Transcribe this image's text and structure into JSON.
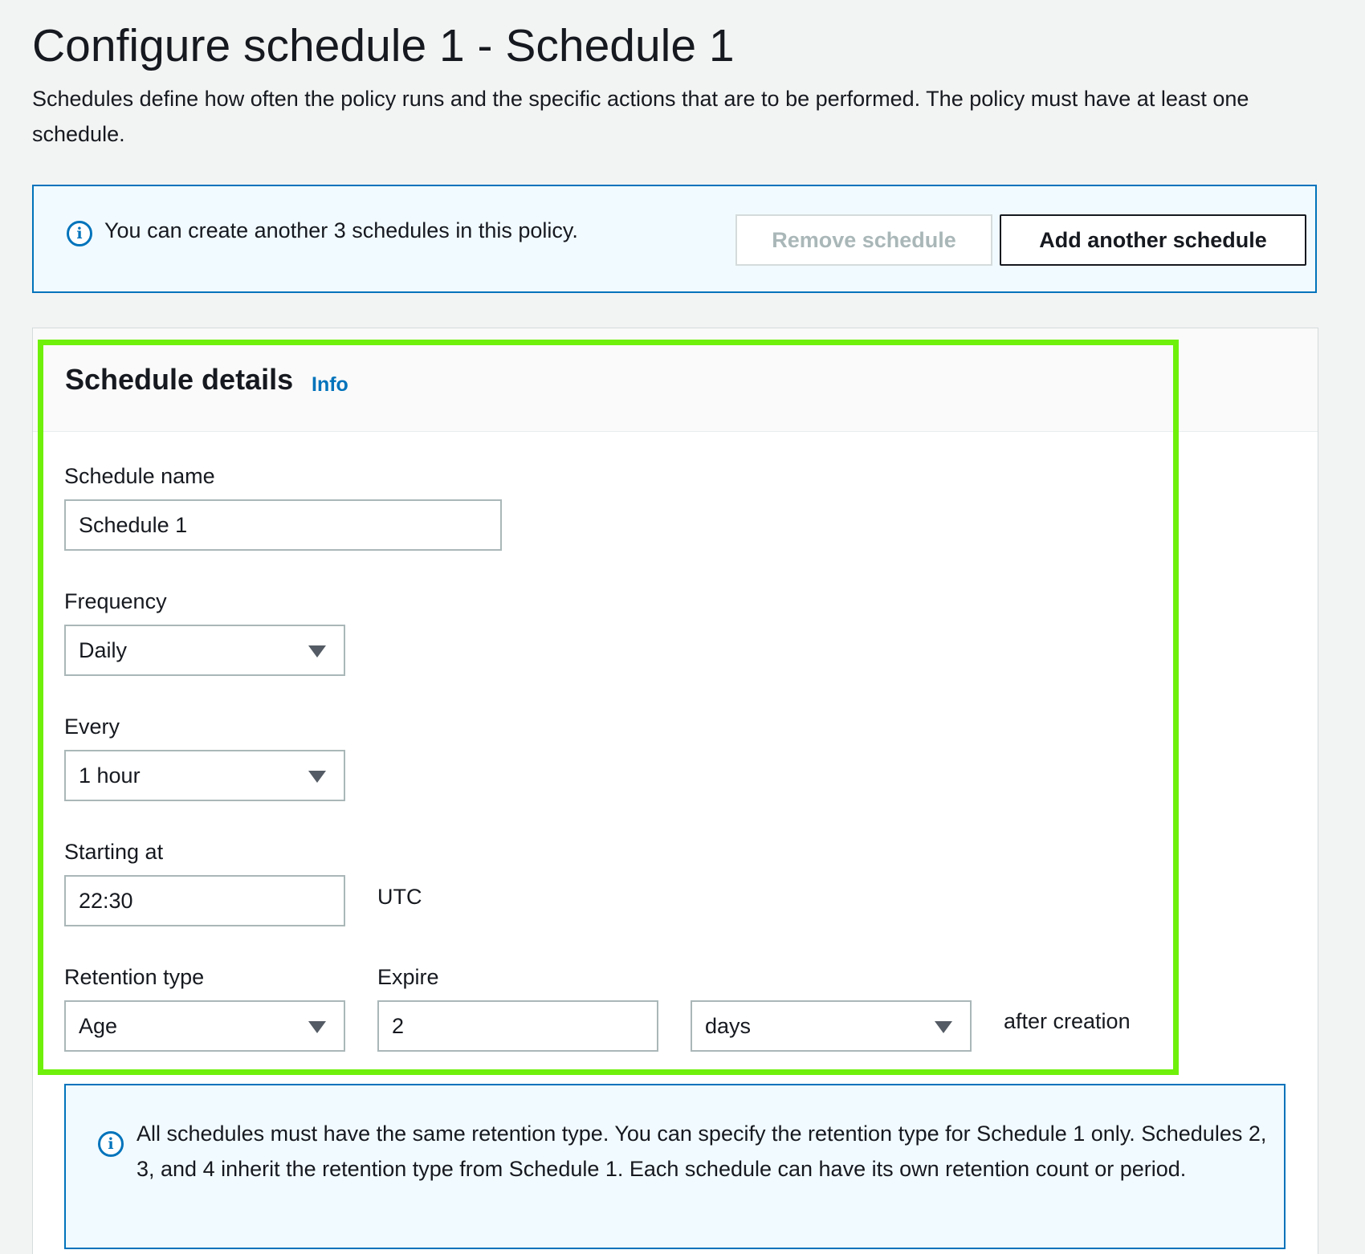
{
  "page": {
    "title": "Configure schedule 1 - Schedule 1",
    "description": "Schedules define how often the policy runs and the specific actions that are to be performed. The policy must have at least one schedule."
  },
  "top_alert": {
    "icon": "info-icon",
    "text": "You can create another 3 schedules in this policy.",
    "remove_label": "Remove schedule",
    "add_label": "Add another schedule"
  },
  "schedule_details": {
    "title": "Schedule details",
    "info_label": "Info",
    "name": {
      "label": "Schedule name",
      "value": "Schedule 1"
    },
    "frequency": {
      "label": "Frequency",
      "value": "Daily"
    },
    "every": {
      "label": "Every",
      "value": "1 hour"
    },
    "starting_at": {
      "label": "Starting at",
      "value": "22:30",
      "suffix": "UTC"
    },
    "retention_type": {
      "label": "Retention type",
      "value": "Age"
    },
    "expire": {
      "label": "Expire",
      "value": "2",
      "unit": "days",
      "suffix": "after creation"
    }
  },
  "bottom_alert": {
    "icon": "info-icon",
    "text": "All schedules must have the same retention type. You can specify the retention type for Schedule 1 only. Schedules 2, 3, and 4 inherit the retention type from Schedule 1. Each schedule can have its own retention count or period."
  },
  "colors": {
    "accent": "#0073bb",
    "highlight": "#6ff00b",
    "background": "#f2f3f3"
  }
}
